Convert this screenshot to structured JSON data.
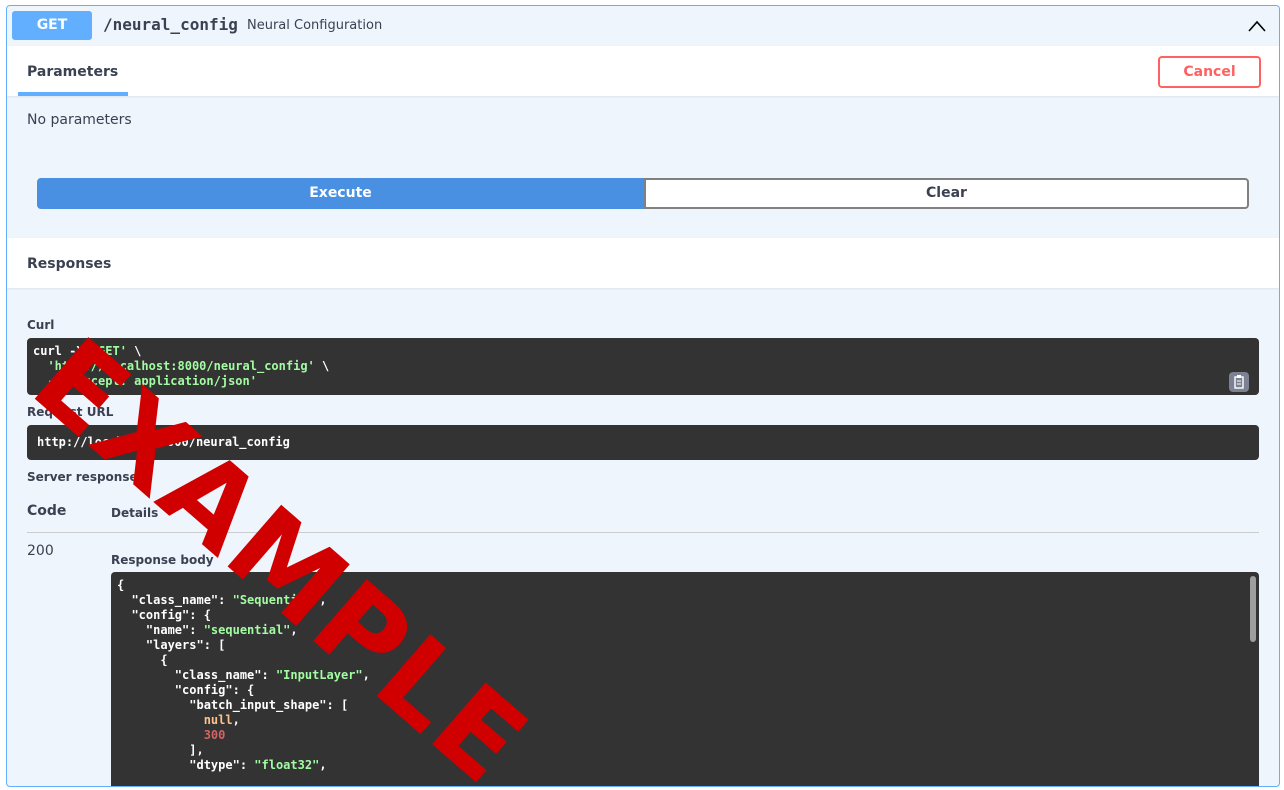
{
  "endpoint": {
    "method": "GET",
    "path": "/neural_config",
    "summary": "Neural Configuration"
  },
  "parameters": {
    "tab_label": "Parameters",
    "cancel_label": "Cancel",
    "empty_text": "No parameters"
  },
  "actions": {
    "execute_label": "Execute",
    "clear_label": "Clear"
  },
  "responses": {
    "title": "Responses",
    "curl_label": "Curl",
    "curl_lines": [
      [
        "curl -X ",
        "'GET'",
        " \\"
      ],
      [
        "  ",
        "'http://localhost:8000/neural_config'",
        " \\"
      ],
      [
        "  -H ",
        "'accept: application/json'",
        ""
      ]
    ],
    "request_url_label": "Request URL",
    "request_url": "http://localhost:8000/neural_config",
    "server_response_label": "Server response",
    "col_code": "Code",
    "col_details": "Details",
    "status_code": "200",
    "response_body_label": "Response body",
    "response_body_lines": [
      {
        "indent": "",
        "parts": [
          [
            "p",
            "{"
          ]
        ]
      },
      {
        "indent": "  ",
        "parts": [
          [
            "p",
            "\"class_name\": "
          ],
          [
            "s",
            "\"Sequential\""
          ],
          [
            "p",
            ","
          ]
        ]
      },
      {
        "indent": "  ",
        "parts": [
          [
            "p",
            "\"config\": {"
          ]
        ]
      },
      {
        "indent": "    ",
        "parts": [
          [
            "p",
            "\"name\": "
          ],
          [
            "s",
            "\"sequential\""
          ],
          [
            "p",
            ","
          ]
        ]
      },
      {
        "indent": "    ",
        "parts": [
          [
            "p",
            "\"layers\": ["
          ]
        ]
      },
      {
        "indent": "      ",
        "parts": [
          [
            "p",
            "{"
          ]
        ]
      },
      {
        "indent": "        ",
        "parts": [
          [
            "p",
            "\"class_name\": "
          ],
          [
            "s",
            "\"InputLayer\""
          ],
          [
            "p",
            ","
          ]
        ]
      },
      {
        "indent": "        ",
        "parts": [
          [
            "p",
            "\"config\": {"
          ]
        ]
      },
      {
        "indent": "          ",
        "parts": [
          [
            "p",
            "\"batch_input_shape\": ["
          ]
        ]
      },
      {
        "indent": "            ",
        "parts": [
          [
            "k",
            "null"
          ],
          [
            "p",
            ","
          ]
        ]
      },
      {
        "indent": "            ",
        "parts": [
          [
            "n",
            "300"
          ]
        ]
      },
      {
        "indent": "          ",
        "parts": [
          [
            "p",
            "],"
          ]
        ]
      },
      {
        "indent": "          ",
        "parts": [
          [
            "p",
            "\"dtype\": "
          ],
          [
            "s",
            "\"float32\""
          ],
          [
            "p",
            ","
          ]
        ]
      }
    ]
  },
  "watermark": {
    "text": "EXAMPLE",
    "color": "#d00000"
  },
  "colors": {
    "get_blue": "#61affe",
    "execute_blue": "#4990e2",
    "cancel_red": "#ff6060",
    "code_bg": "#333333"
  }
}
